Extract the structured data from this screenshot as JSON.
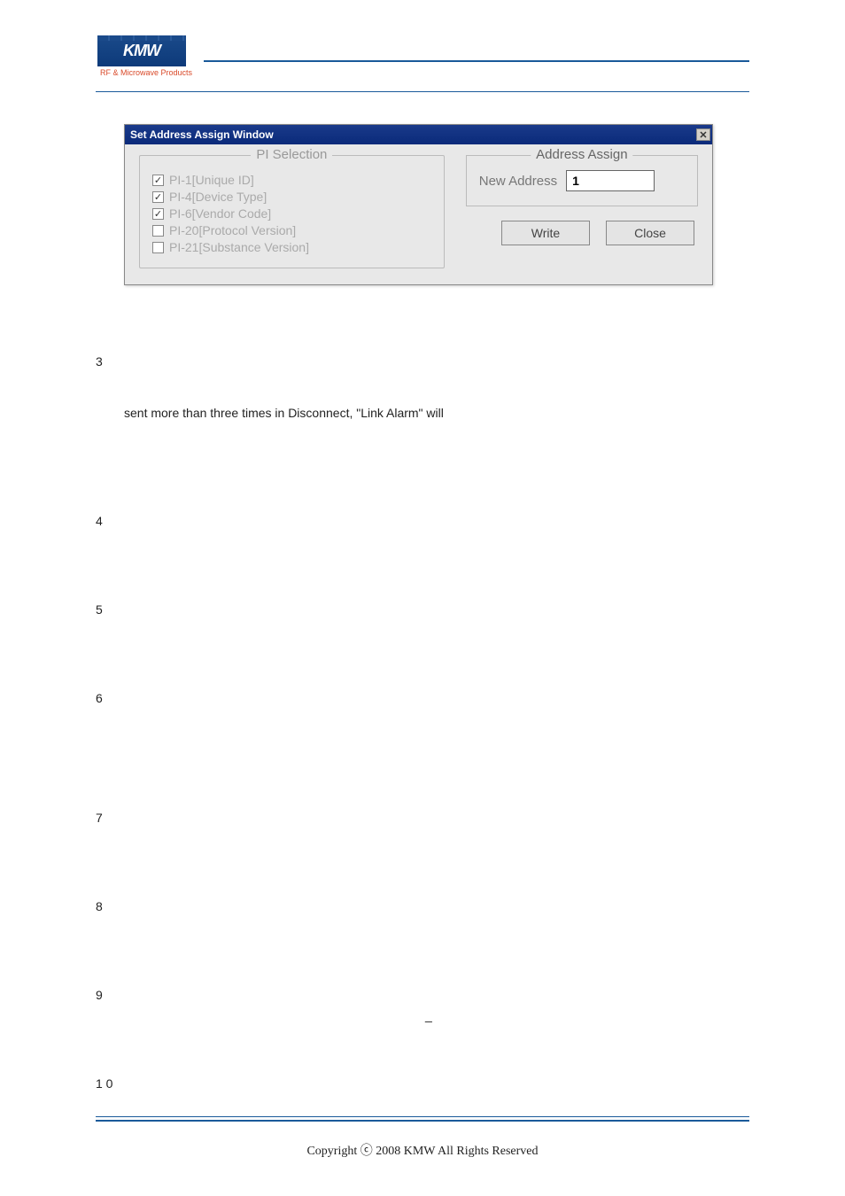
{
  "logo": {
    "text": "KMW",
    "tagline": "RF & Microwave Products"
  },
  "dialog": {
    "title": "Set Address Assign Window",
    "close_label": "✕",
    "pi_selection": {
      "legend": "PI Selection",
      "items": [
        {
          "checked": true,
          "label": "PI-1[Unique ID]"
        },
        {
          "checked": true,
          "label": "PI-4[Device Type]"
        },
        {
          "checked": true,
          "label": "PI-6[Vendor Code]"
        },
        {
          "checked": false,
          "label": "PI-20[Protocol Version]"
        },
        {
          "checked": false,
          "label": "PI-21[Substance Version]"
        }
      ]
    },
    "address_assign": {
      "legend": "Address Assign",
      "new_address_label": "New Address",
      "new_address_value": "1"
    },
    "buttons": {
      "write": "Write",
      "close": "Close"
    }
  },
  "body_line": "sent more than three times in Disconnect, \"Link Alarm\" will",
  "markers": [
    "3",
    "4",
    "5",
    "6",
    "7",
    "8",
    "9",
    "1 0"
  ],
  "dash": "_",
  "copyright": "Copyright ⓒ 2008 KMW All Rights Reserved"
}
